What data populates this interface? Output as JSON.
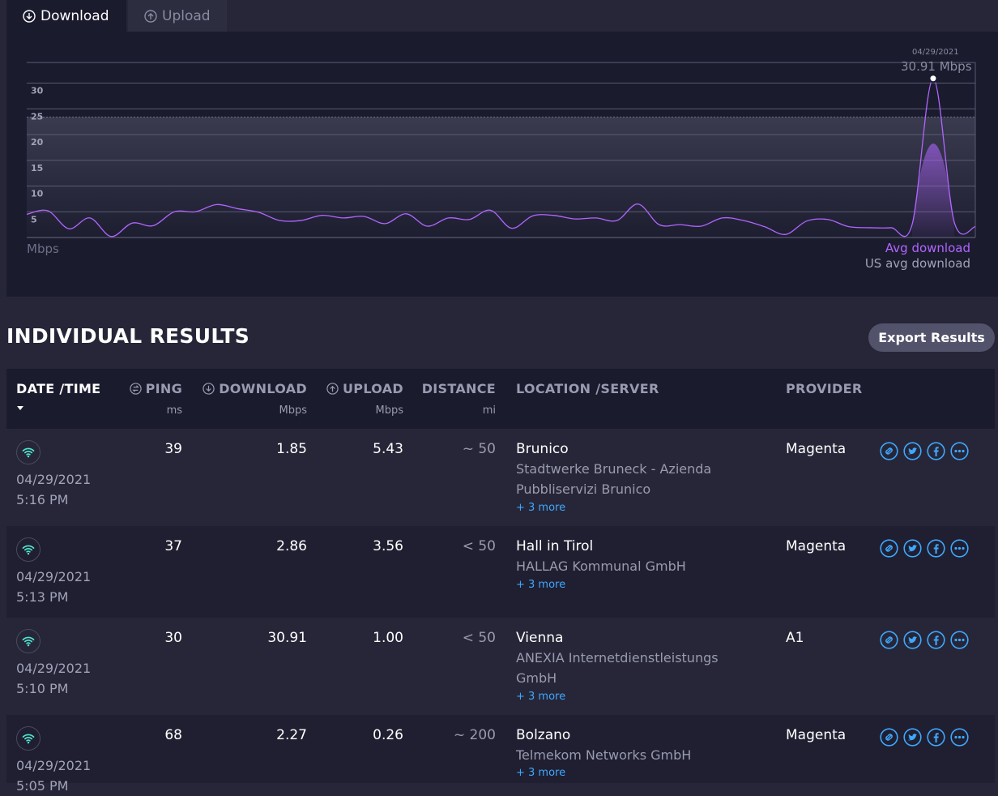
{
  "tabs": [
    {
      "label": "Download",
      "icon": "download-circle-icon",
      "active": true
    },
    {
      "label": "Upload",
      "icon": "upload-circle-icon",
      "active": false
    }
  ],
  "chart_data": {
    "type": "line",
    "ylabel": "Mbps",
    "yticks": [
      5,
      10,
      15,
      20,
      25,
      30
    ],
    "ylim": [
      0,
      34
    ],
    "grid": true,
    "series": [
      {
        "name": "Avg download",
        "color": "#b066ff",
        "values": [
          4.5,
          5.2,
          1.7,
          3.8,
          0.2,
          2.8,
          2.3,
          5,
          5,
          6.4,
          5.6,
          4.9,
          3.3,
          3.3,
          4.3,
          3.8,
          4.1,
          2.7,
          4.6,
          2.2,
          3.8,
          3.5,
          5.3,
          1.8,
          4.2,
          4.3,
          3.6,
          3.8,
          3.3,
          6.5,
          2.5,
          2.5,
          2.2,
          3.8,
          3.3,
          2.1,
          0.6,
          3.2,
          3.5,
          2.1,
          1.9,
          1.9,
          2.5,
          30.91,
          3,
          2.1
        ]
      },
      {
        "name": "US avg download",
        "color": "#a2a2b8",
        "band": [
          21.2,
          23.4
        ]
      }
    ],
    "peak": {
      "date": "04/29/2021",
      "value_label": "30.91 Mbps",
      "value": 30.91
    }
  },
  "chart_labels": {
    "unit": "Mbps",
    "legend_avg": "Avg download",
    "legend_us": "US avg download",
    "peak_date": "04/29/2021",
    "peak_value": "30.91 Mbps"
  },
  "results": {
    "title": "INDIVIDUAL RESULTS",
    "export_label": "Export Results"
  },
  "columns": [
    {
      "label": "DATE /TIME",
      "unit": "",
      "icon": ""
    },
    {
      "label": "PING",
      "unit": "ms",
      "icon": "ping-icon"
    },
    {
      "label": "DOWNLOAD",
      "unit": "Mbps",
      "icon": "download-circle-icon"
    },
    {
      "label": "UPLOAD",
      "unit": "Mbps",
      "icon": "upload-circle-icon"
    },
    {
      "label": "DISTANCE",
      "unit": "mi",
      "icon": ""
    },
    {
      "label": "LOCATION /SERVER",
      "unit": "",
      "icon": ""
    },
    {
      "label": "PROVIDER",
      "unit": "",
      "icon": ""
    }
  ],
  "rows": [
    {
      "date": "04/29/2021",
      "time": "5:16 PM",
      "ping": "39",
      "download": "1.85",
      "upload": "5.43",
      "distance": "~ 50",
      "location": "Brunico",
      "server": "Stadtwerke Bruneck - Azienda Pubbliservizi Brunico",
      "more": "+ 3 more",
      "provider": "Magenta"
    },
    {
      "date": "04/29/2021",
      "time": "5:13 PM",
      "ping": "37",
      "download": "2.86",
      "upload": "3.56",
      "distance": "< 50",
      "location": "Hall in Tirol",
      "server": "HALLAG Kommunal GmbH",
      "more": "+ 3 more",
      "provider": "Magenta"
    },
    {
      "date": "04/29/2021",
      "time": "5:10 PM",
      "ping": "30",
      "download": "30.91",
      "upload": "1.00",
      "distance": "< 50",
      "location": "Vienna",
      "server": "ANEXIA Internetdienstleistungs GmbH",
      "more": "+ 3 more",
      "provider": "A1"
    },
    {
      "date": "04/29/2021",
      "time": "5:05 PM",
      "ping": "68",
      "download": "2.27",
      "upload": "0.26",
      "distance": "~ 200",
      "location": "Bolzano",
      "server": "Telmekom Networks GmbH",
      "more": "+ 3 more",
      "provider": "Magenta"
    }
  ]
}
